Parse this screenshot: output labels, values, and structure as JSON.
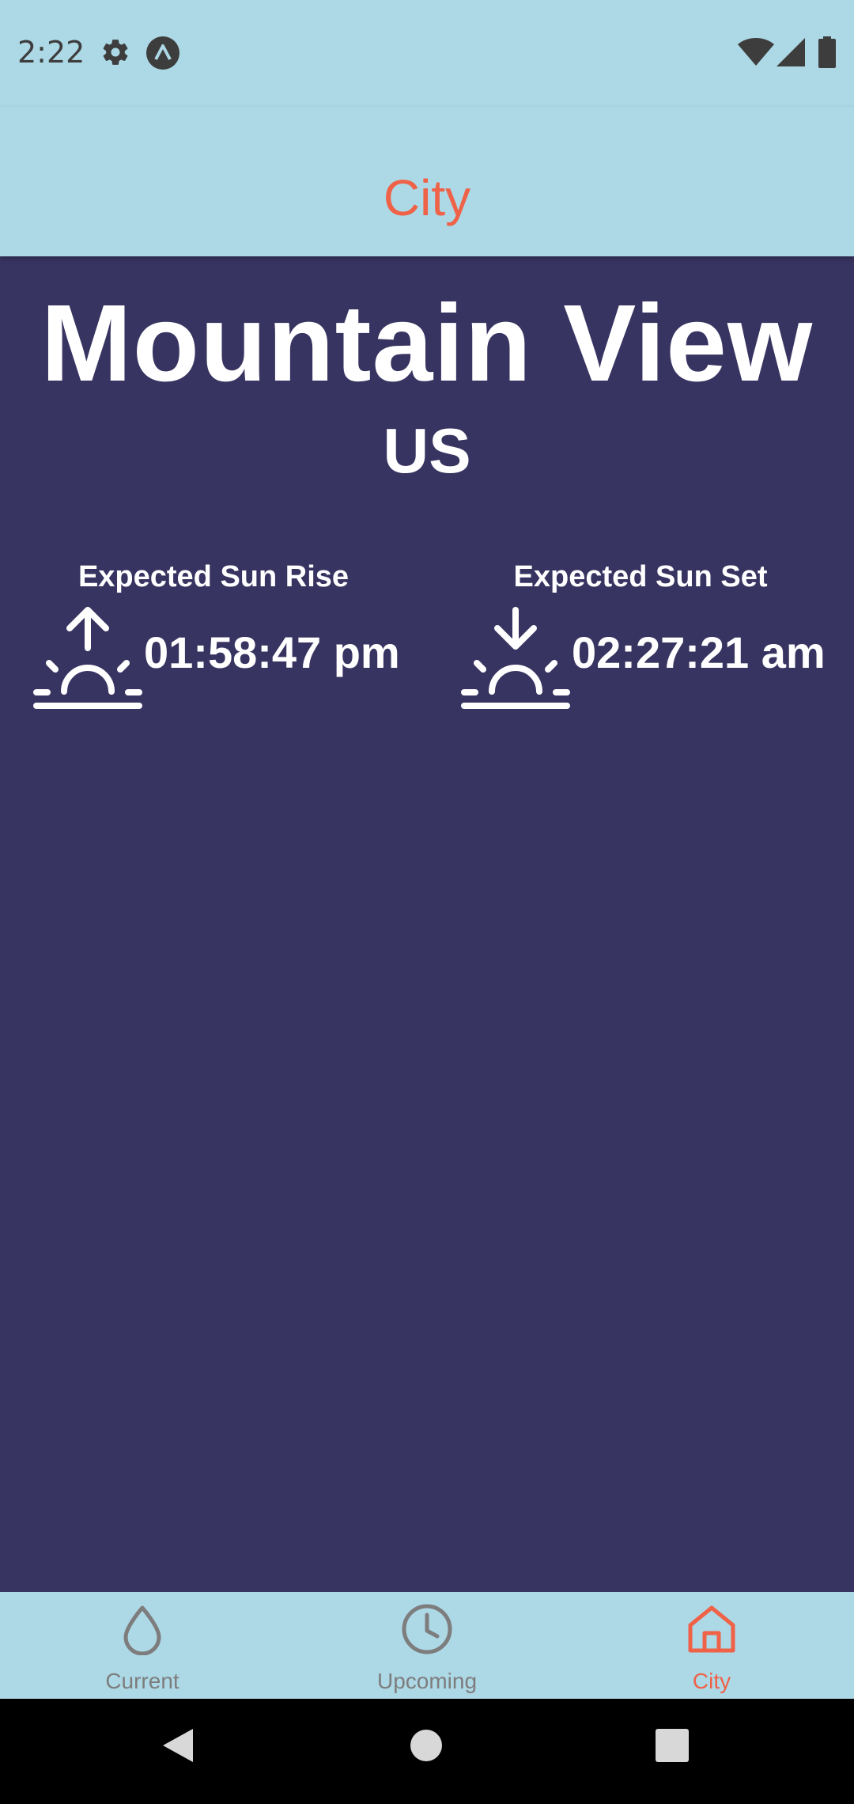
{
  "status_bar": {
    "time": "2:22",
    "icons": [
      "gear-icon",
      "app-notification-icon",
      "wifi-icon",
      "cellular-signal-icon",
      "battery-icon"
    ]
  },
  "header": {
    "title": "City"
  },
  "city": {
    "name": "Mountain View",
    "country": "US"
  },
  "sun": {
    "rise_label": "Expected Sun Rise",
    "rise_time": "01:58:47 pm",
    "set_label": "Expected Sun Set",
    "set_time": "02:27:21 am"
  },
  "bottom_nav": {
    "items": [
      {
        "label": "Current",
        "icon": "water-drop-icon"
      },
      {
        "label": "Upcoming",
        "icon": "clock-icon"
      },
      {
        "label": "City",
        "icon": "home-icon"
      }
    ],
    "active_index": 2
  },
  "colors": {
    "accent": "#ef6248",
    "bar_background": "#add8e6",
    "content_background": "#383461",
    "inactive": "#7d7d7d"
  }
}
